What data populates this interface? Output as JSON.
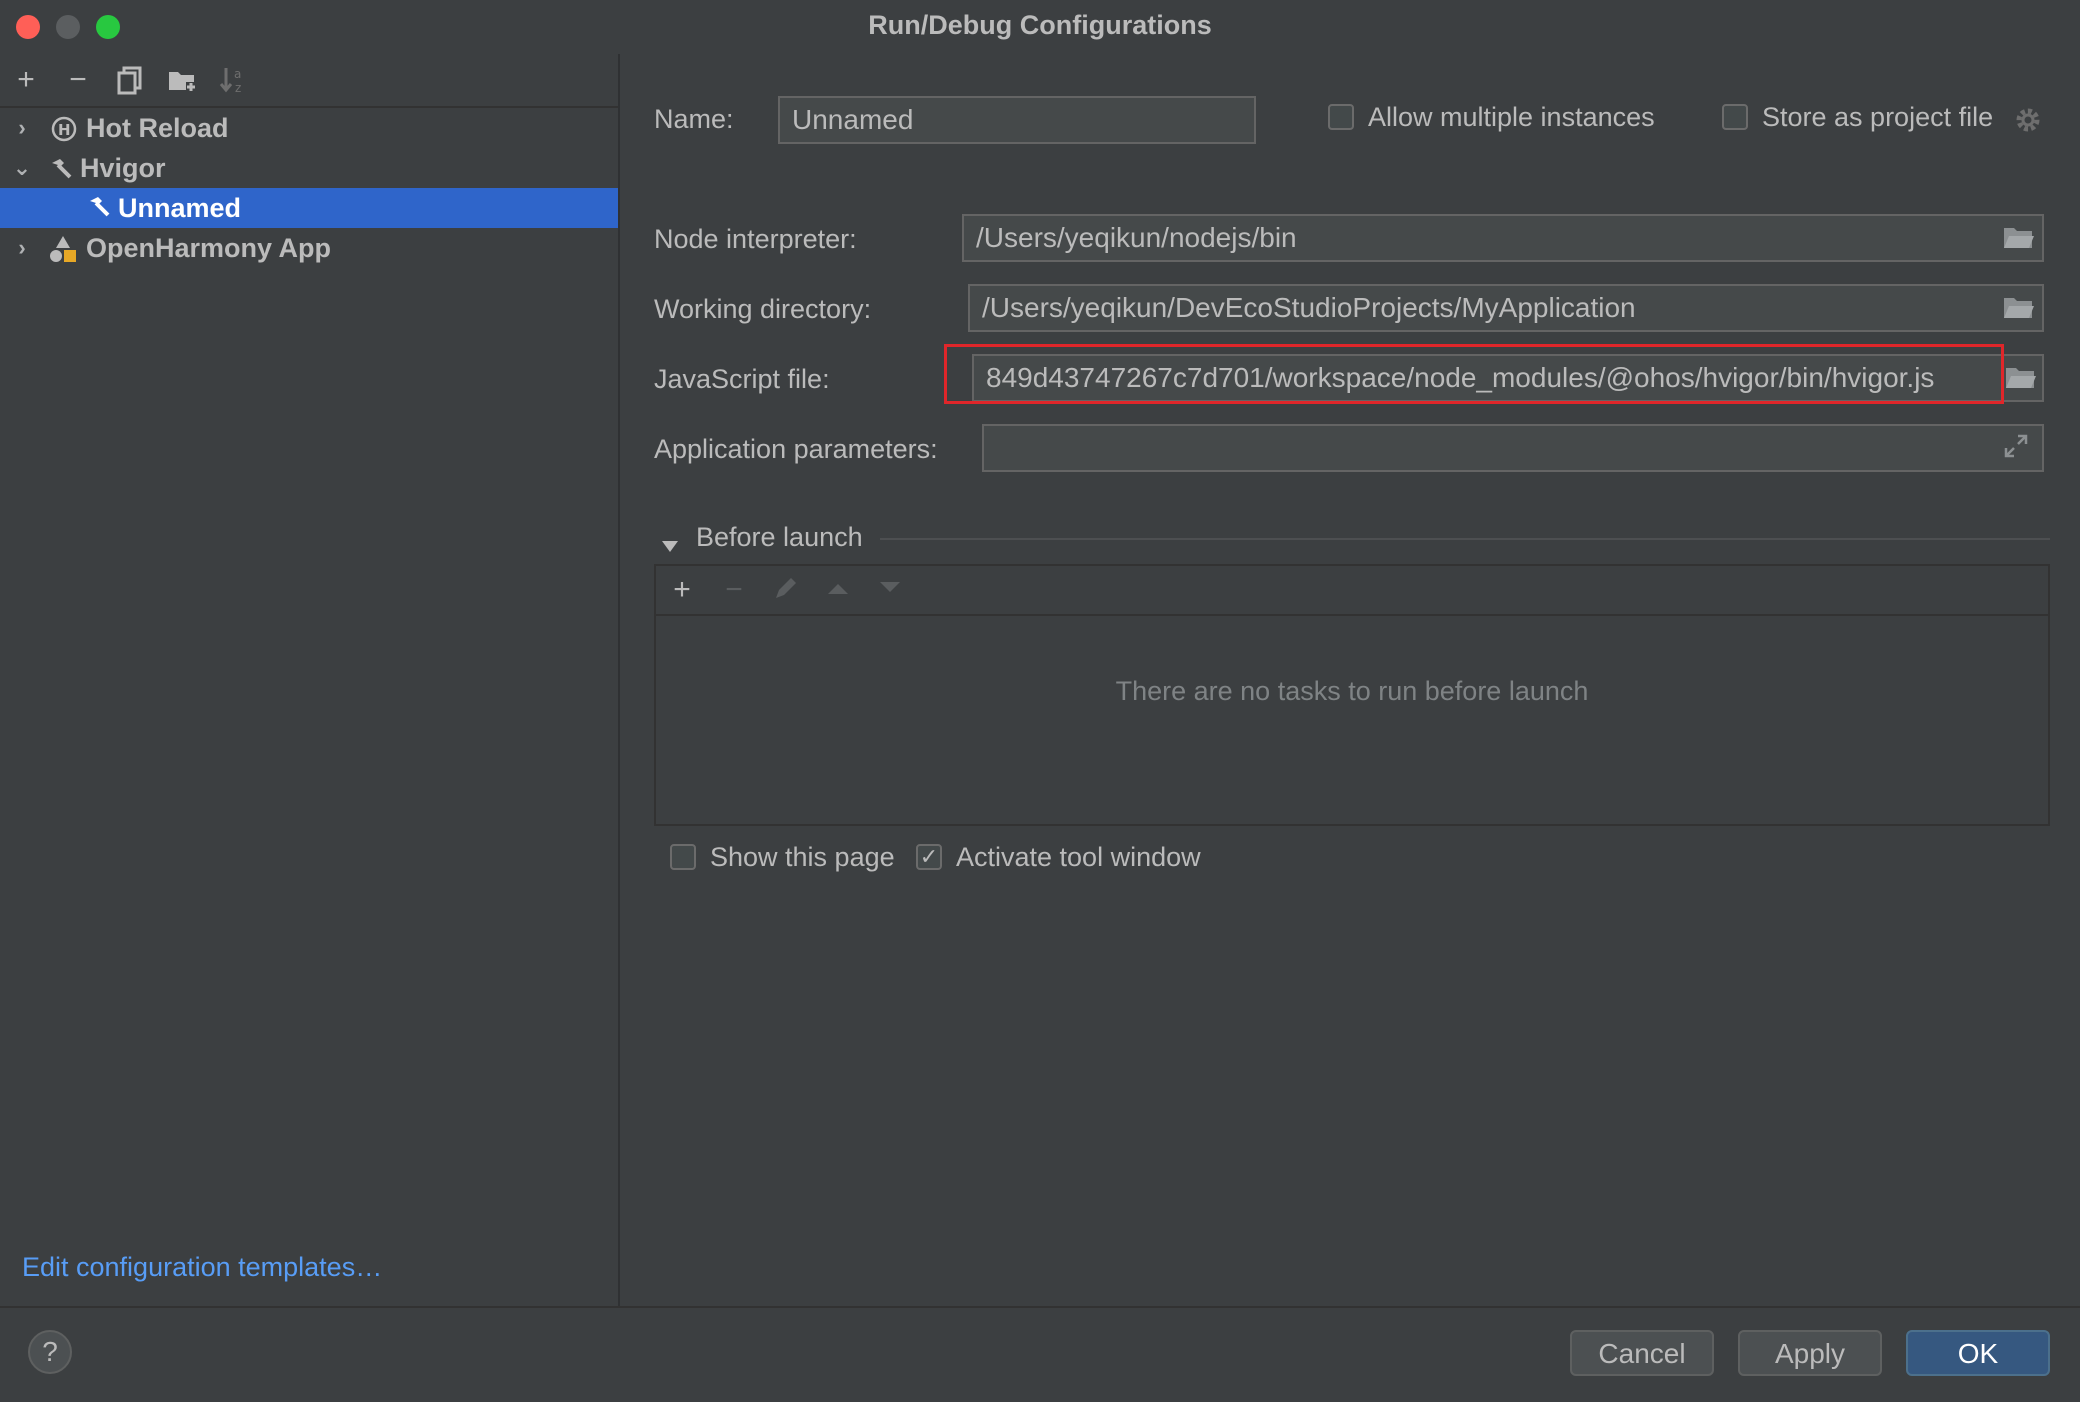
{
  "window": {
    "title": "Run/Debug Configurations"
  },
  "sidebar": {
    "toolbar": [
      {
        "icon": "add-icon",
        "glyph": "+"
      },
      {
        "icon": "remove-icon",
        "glyph": "−"
      },
      {
        "icon": "copy-icon",
        "glyph": "⧉"
      },
      {
        "icon": "folder-add-icon",
        "glyph": "▬"
      },
      {
        "icon": "sort-icon",
        "glyph": "↓"
      }
    ],
    "tree": [
      {
        "label": "Hot Reload",
        "icon": "hot-reload-icon",
        "expanded": false
      },
      {
        "label": "Hvigor",
        "icon": "hammer-icon",
        "expanded": true
      },
      {
        "label": "Unnamed",
        "icon": "hammer-icon",
        "selected": true
      },
      {
        "label": "OpenHarmony App",
        "icon": "app-icon",
        "expanded": false
      }
    ],
    "edit_templates_link": "Edit configuration templates…"
  },
  "form": {
    "name_label": "Name:",
    "name_value": "Unnamed",
    "allow_multiple_label": "Allow multiple instances",
    "allow_multiple_checked": false,
    "store_project_label": "Store as project file",
    "store_project_checked": false,
    "node_interpreter_label": "Node interpreter:",
    "node_interpreter_value": "/Users/yeqikun/nodejs/bin",
    "working_dir_label": "Working directory:",
    "working_dir_value": "/Users/yeqikun/DevEcoStudioProjects/MyApplication",
    "js_file_label": "JavaScript file:",
    "js_file_value": "849d43747267c7d701/workspace/node_modules/@ohos/hvigor/bin/hvigor.js",
    "app_params_label": "Application parameters:",
    "app_params_value": ""
  },
  "before_launch": {
    "title": "Before launch",
    "empty_text": "There are no tasks to run before launch",
    "show_page_label": "Show this page",
    "show_page_checked": false,
    "activate_tool_label": "Activate tool window",
    "activate_tool_checked": true
  },
  "buttons": {
    "help": "?",
    "cancel": "Cancel",
    "apply": "Apply",
    "ok": "OK"
  },
  "colors": {
    "background": "#3c3f41",
    "selection": "#2f65ca",
    "link": "#589df6",
    "highlight_box": "#e0262a",
    "primary_button": "#365880"
  }
}
